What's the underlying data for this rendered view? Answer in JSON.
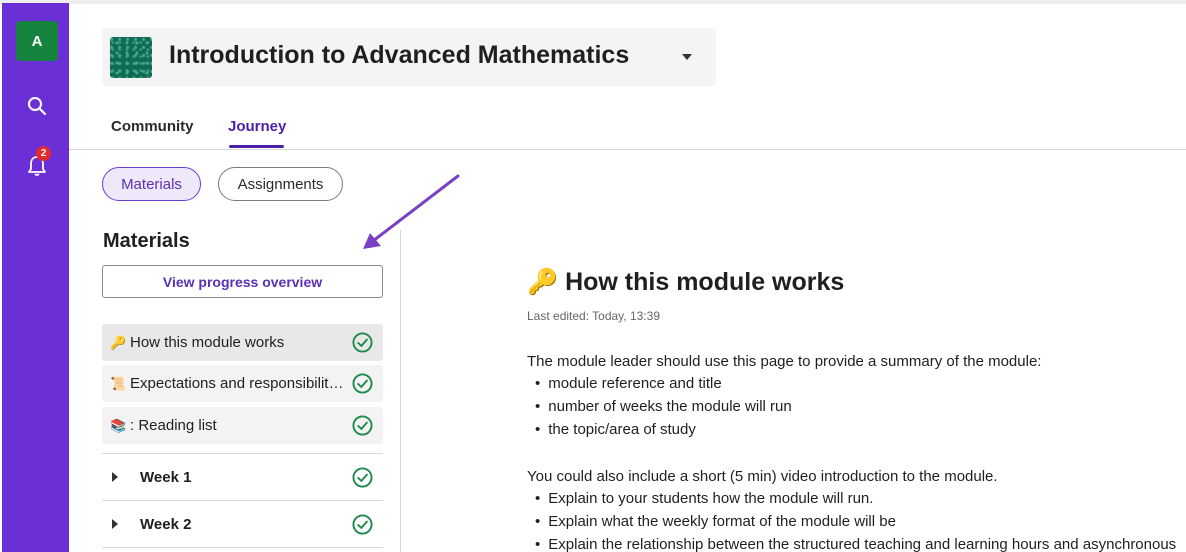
{
  "rail": {
    "avatar_initial": "A",
    "notification_count": "2"
  },
  "header": {
    "course_title": "Introduction to Advanced Mathematics"
  },
  "tabs": [
    {
      "label": "Community"
    },
    {
      "label": "Journey"
    }
  ],
  "filters": {
    "materials_label": "Materials",
    "assignments_label": "Assignments"
  },
  "sidebar": {
    "title": "Materials",
    "progress_button": "View progress overview",
    "items": [
      {
        "emoji": "🔑",
        "label": "How this module works"
      },
      {
        "emoji": "📜",
        "label": "Expectations and responsibilities"
      },
      {
        "emoji": "📚",
        "label": ": Reading list"
      }
    ],
    "weeks": [
      {
        "label": "Week 1"
      },
      {
        "label": "Week 2"
      }
    ]
  },
  "content": {
    "heading_emoji": "🔑",
    "heading": "How this module works",
    "last_edited": "Last edited: Today, 13:39",
    "intro": "The module leader should use this page to provide a summary of the module:",
    "intro_bullets": [
      "module reference and title",
      "number of weeks the module will run",
      "the topic/area of study"
    ],
    "video_intro": "You could also include a short (5 min) video introduction to the module.",
    "video_bullets": [
      "Explain to your students how the module will run.",
      "Explain what the weekly format of the module will be",
      "Explain the relationship between the structured teaching and learning hours and asynchronous"
    ]
  },
  "colors": {
    "rail": "#6b2fd6",
    "accent": "#4b1fa8",
    "avatar": "#16843f",
    "check": "#1e8a4c",
    "annotation_arrow": "#7b3fc4"
  }
}
